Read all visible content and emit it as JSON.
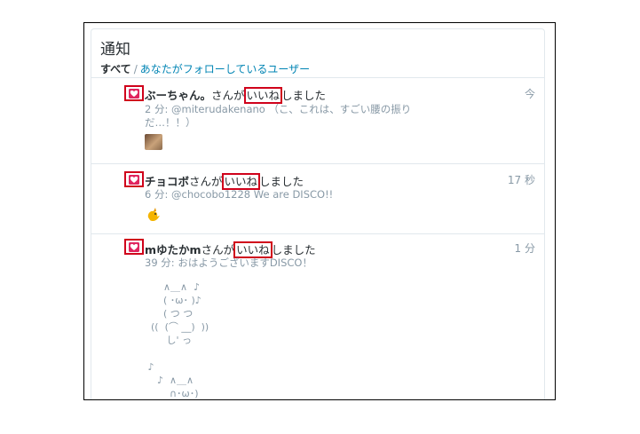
{
  "header": {
    "title": "通知",
    "tab_all": "すべて",
    "separator": "/",
    "tab_following": "あなたがフォローしているユーザー"
  },
  "notifications": [
    {
      "name": "ぶーちゃん。",
      "suffix": "さんが",
      "like_word": "いいね",
      "action": "しました",
      "time": "今",
      "detail_line1": "2 分: @miterudakenano （こ、これは、すごい腰の振り",
      "detail_line2": "だ…！！）",
      "icon": "heart-icon"
    },
    {
      "name": "チョコボ",
      "suffix": "さんが",
      "like_word": "いいね",
      "action": "しました",
      "time": "17 秒",
      "detail_line1": "6 分: @chocobo1228 We are DISCO!!",
      "icon": "heart-icon"
    },
    {
      "name": "mゆたかm",
      "suffix": "さんが",
      "like_word": "いいね",
      "action": "しました",
      "time": "1 分",
      "detail_line1": "39 分: おはようございますDISCO！",
      "ascii_art": "      ∧＿∧  ♪\n      ( ･ω･ )♪\n      ( つ つ\n  ((  (⌒ __)  ))\n       し' っ\n\n ♪\n    ♪  ∧＿∧\n        ∩･ω･)"
    }
  ],
  "colors": {
    "highlight_box": "#d0021b",
    "heart": "#e0245e",
    "link": "#0084b4",
    "muted": "#8899a6"
  }
}
